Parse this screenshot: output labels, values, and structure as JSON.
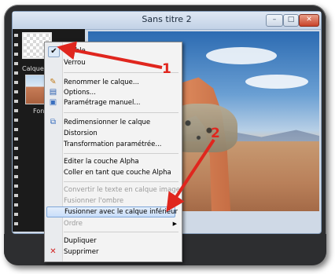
{
  "window": {
    "title": "Sans titre 2",
    "buttons": {
      "minimize": "–",
      "maximize": "□",
      "close": "✕"
    }
  },
  "layers": [
    {
      "label": "Calque"
    },
    {
      "label": "Fond"
    }
  ],
  "menu": {
    "items": [
      {
        "label": "Visible",
        "icon": "check-icon",
        "checked": true
      },
      {
        "label": "Verrou"
      },
      {
        "separator": true
      },
      {
        "label": "Renommer le calque...",
        "icon": "rename-icon"
      },
      {
        "label": "Options...",
        "icon": "options-icon"
      },
      {
        "label": "Paramétrage manuel...",
        "icon": "settings-icon"
      },
      {
        "separator": true
      },
      {
        "label": "Redimensionner le calque",
        "icon": "resize-icon"
      },
      {
        "label": "Distorsion"
      },
      {
        "label": "Transformation paramétrée..."
      },
      {
        "separator": true
      },
      {
        "label": "Editer la couche Alpha"
      },
      {
        "label": "Coller en tant que couche Alpha"
      },
      {
        "separator": true
      },
      {
        "label": "Convertir le texte en calque image",
        "disabled": true
      },
      {
        "label": "Fusionner l'ombre",
        "disabled": true
      },
      {
        "label": "Fusionner avec le calque inférieur",
        "highlighted": true
      },
      {
        "label": "Ordre",
        "disabled": true,
        "submenu": true
      },
      {
        "separator": true
      },
      {
        "label": "Dupliquer"
      },
      {
        "label": "Supprimer",
        "icon": "delete-icon"
      }
    ]
  },
  "callouts": {
    "one": "1",
    "two": "2"
  },
  "colors": {
    "callout": "#e0261e",
    "highlight": "#c9defa",
    "delete": "#d22020"
  }
}
